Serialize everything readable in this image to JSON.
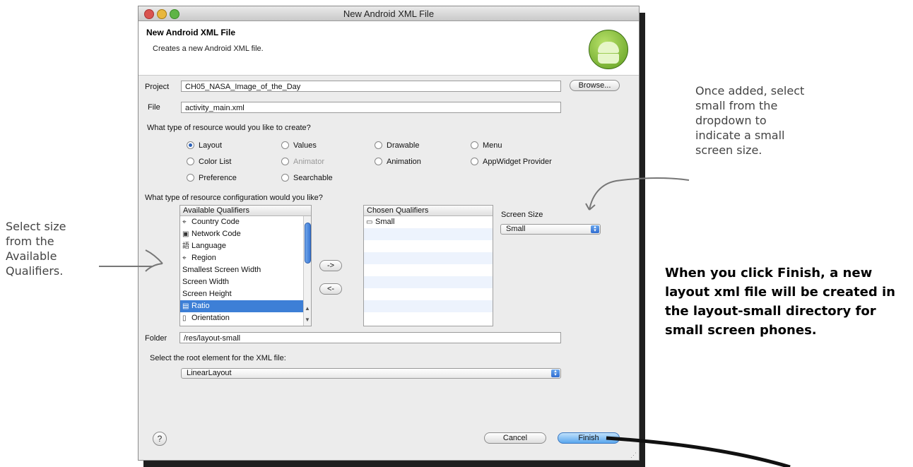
{
  "window": {
    "title": "New Android XML File"
  },
  "header": {
    "title": "New Android XML File",
    "subtitle": "Creates a new Android XML file."
  },
  "form": {
    "project_label": "Project",
    "project_value": "CH05_NASA_Image_of_the_Day",
    "browse_label": "Browse...",
    "file_label": "File",
    "file_value": "activity_main.xml",
    "resource_question": "What type of resource would you like to create?",
    "resource_types": {
      "layout": "Layout",
      "values": "Values",
      "drawable": "Drawable",
      "menu": "Menu",
      "color_list": "Color List",
      "animator": "Animator",
      "animation": "Animation",
      "appwidget": "AppWidget Provider",
      "preference": "Preference",
      "searchable": "Searchable"
    },
    "selected_resource_type": "Layout",
    "config_question": "What type of resource configuration would you like?",
    "available_header": "Available Qualifiers",
    "available_items": [
      {
        "icon": "country-code-icon",
        "glyph": "⌖",
        "label": "Country Code"
      },
      {
        "icon": "network-code-icon",
        "glyph": "▣",
        "label": "Network Code"
      },
      {
        "icon": "language-icon",
        "glyph": "語",
        "label": "Language"
      },
      {
        "icon": "region-icon",
        "glyph": "⌖",
        "label": "Region"
      },
      {
        "icon": "",
        "glyph": "",
        "label": "Smallest Screen Width"
      },
      {
        "icon": "",
        "glyph": "",
        "label": "Screen Width"
      },
      {
        "icon": "",
        "glyph": "",
        "label": "Screen Height"
      },
      {
        "icon": "ratio-icon",
        "glyph": "▤",
        "label": "Ratio"
      },
      {
        "icon": "orientation-icon",
        "glyph": "▯",
        "label": "Orientation"
      }
    ],
    "selected_available": "Ratio",
    "add_label": "->",
    "remove_label": "<-",
    "chosen_header": "Chosen Qualifiers",
    "chosen_items": [
      {
        "icon": "screen-size-icon",
        "glyph": "▭",
        "label": "Small"
      }
    ],
    "screen_size_label": "Screen Size",
    "screen_size_value": "Small",
    "folder_label": "Folder",
    "folder_value": "/res/layout-small",
    "root_label": "Select the root element for the XML file:",
    "root_value": "LinearLayout"
  },
  "footer": {
    "help_label": "?",
    "cancel_label": "Cancel",
    "finish_label": "Finish"
  },
  "annotations": {
    "left_note": "Select size\nfrom the\nAvailable\nQualifiers.",
    "right_note": "Once added, select\nsmall from the\ndropdown to\nindicate a small\nscreen size.",
    "callout": "When you click Finish, a new layout xml file will be created in the layout-small directory for small screen phones."
  }
}
